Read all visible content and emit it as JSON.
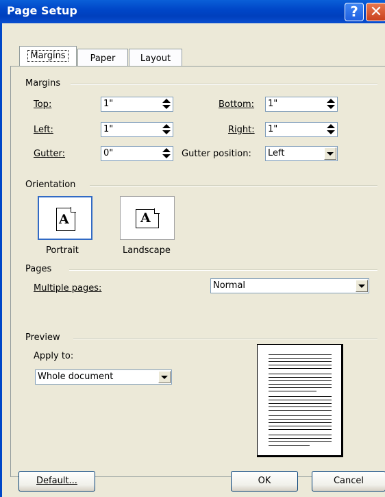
{
  "window": {
    "title": "Page Setup",
    "help_glyph": "?",
    "close_glyph": "✕"
  },
  "tabs": [
    {
      "label": "Margins",
      "active": true
    },
    {
      "label": "Paper",
      "active": false
    },
    {
      "label": "Layout",
      "active": false
    }
  ],
  "margins": {
    "group_label": "Margins",
    "top": {
      "label": "Top:",
      "value": "1\""
    },
    "bottom": {
      "label": "Bottom:",
      "value": "1\""
    },
    "left": {
      "label": "Left:",
      "value": "1\""
    },
    "right": {
      "label": "Right:",
      "value": "1\""
    },
    "gutter": {
      "label": "Gutter:",
      "value": "0\""
    },
    "gutter_position": {
      "label": "Gutter position:",
      "value": "Left"
    }
  },
  "orientation": {
    "group_label": "Orientation",
    "portrait": {
      "label": "Portrait",
      "glyph": "A",
      "selected": true
    },
    "landscape": {
      "label": "Landscape",
      "glyph": "A",
      "selected": false
    }
  },
  "pages": {
    "group_label": "Pages",
    "multiple_pages_label": "Multiple pages:",
    "multiple_pages_value": "Normal"
  },
  "preview": {
    "group_label": "Preview",
    "apply_to_label": "Apply to:",
    "apply_to_value": "Whole document"
  },
  "buttons": {
    "default": "Default...",
    "ok": "OK",
    "cancel": "Cancel"
  },
  "colors": {
    "titlebar": "#0047c8",
    "dialog_bg": "#ece9d8",
    "selection_border": "#316ac5"
  }
}
